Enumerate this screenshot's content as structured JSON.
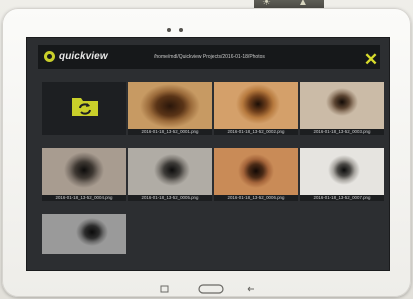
{
  "app": {
    "name": "quickview",
    "path": "/home/mdl/Quickview Projects/2016-01-18/Photos",
    "close_glyph": "✕",
    "accent_color": "#c9cf2a"
  },
  "folder": {
    "icon": "folder-back-icon"
  },
  "photos": [
    {
      "caption": "2016-01-18_13-52_0001.png",
      "tone": "brown"
    },
    {
      "caption": "2016-01-18_13-52_0002.png",
      "tone": "rust"
    },
    {
      "caption": "2016-01-18_13-52_0003.png",
      "tone": "grey-brown"
    },
    {
      "caption": "2016-01-18_13-52_0004.png",
      "tone": "dark-grey"
    },
    {
      "caption": "2016-01-18_13-52_0005.png",
      "tone": "grey"
    },
    {
      "caption": "2016-01-18_13-52_0006.png",
      "tone": "orange"
    },
    {
      "caption": "2016-01-18_13-52_0007.png",
      "tone": "white"
    },
    {
      "caption": "",
      "tone": "dark"
    }
  ]
}
